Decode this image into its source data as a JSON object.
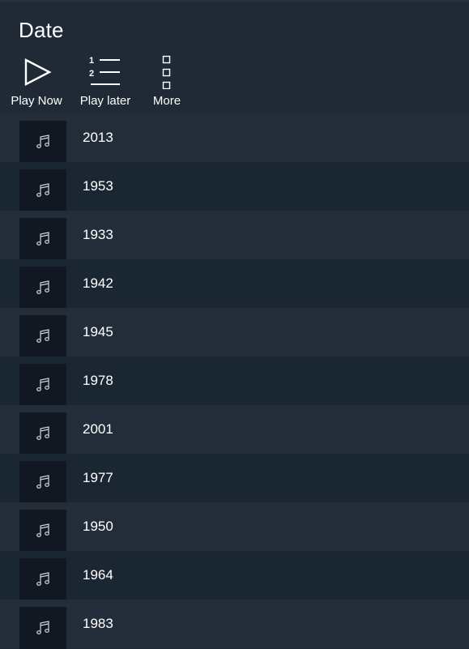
{
  "header": {
    "title": "Date"
  },
  "actions": {
    "play_now": "Play Now",
    "play_later": "Play later",
    "more": "More"
  },
  "list": {
    "items": [
      {
        "label": "2013"
      },
      {
        "label": "1953"
      },
      {
        "label": "1933"
      },
      {
        "label": "1942"
      },
      {
        "label": "1945"
      },
      {
        "label": "1978"
      },
      {
        "label": "2001"
      },
      {
        "label": "1977"
      },
      {
        "label": "1950"
      },
      {
        "label": "1964"
      },
      {
        "label": "1983"
      }
    ]
  },
  "icons": {
    "play": "play-icon",
    "queue": "numbered-list-icon",
    "more": "more-icon",
    "item": "music-note-icon"
  },
  "colors": {
    "background": "#1f2a36",
    "row_alt": "#232d39",
    "row_dark": "#1b2633",
    "thumb": "#111821",
    "text": "#ffffff"
  }
}
